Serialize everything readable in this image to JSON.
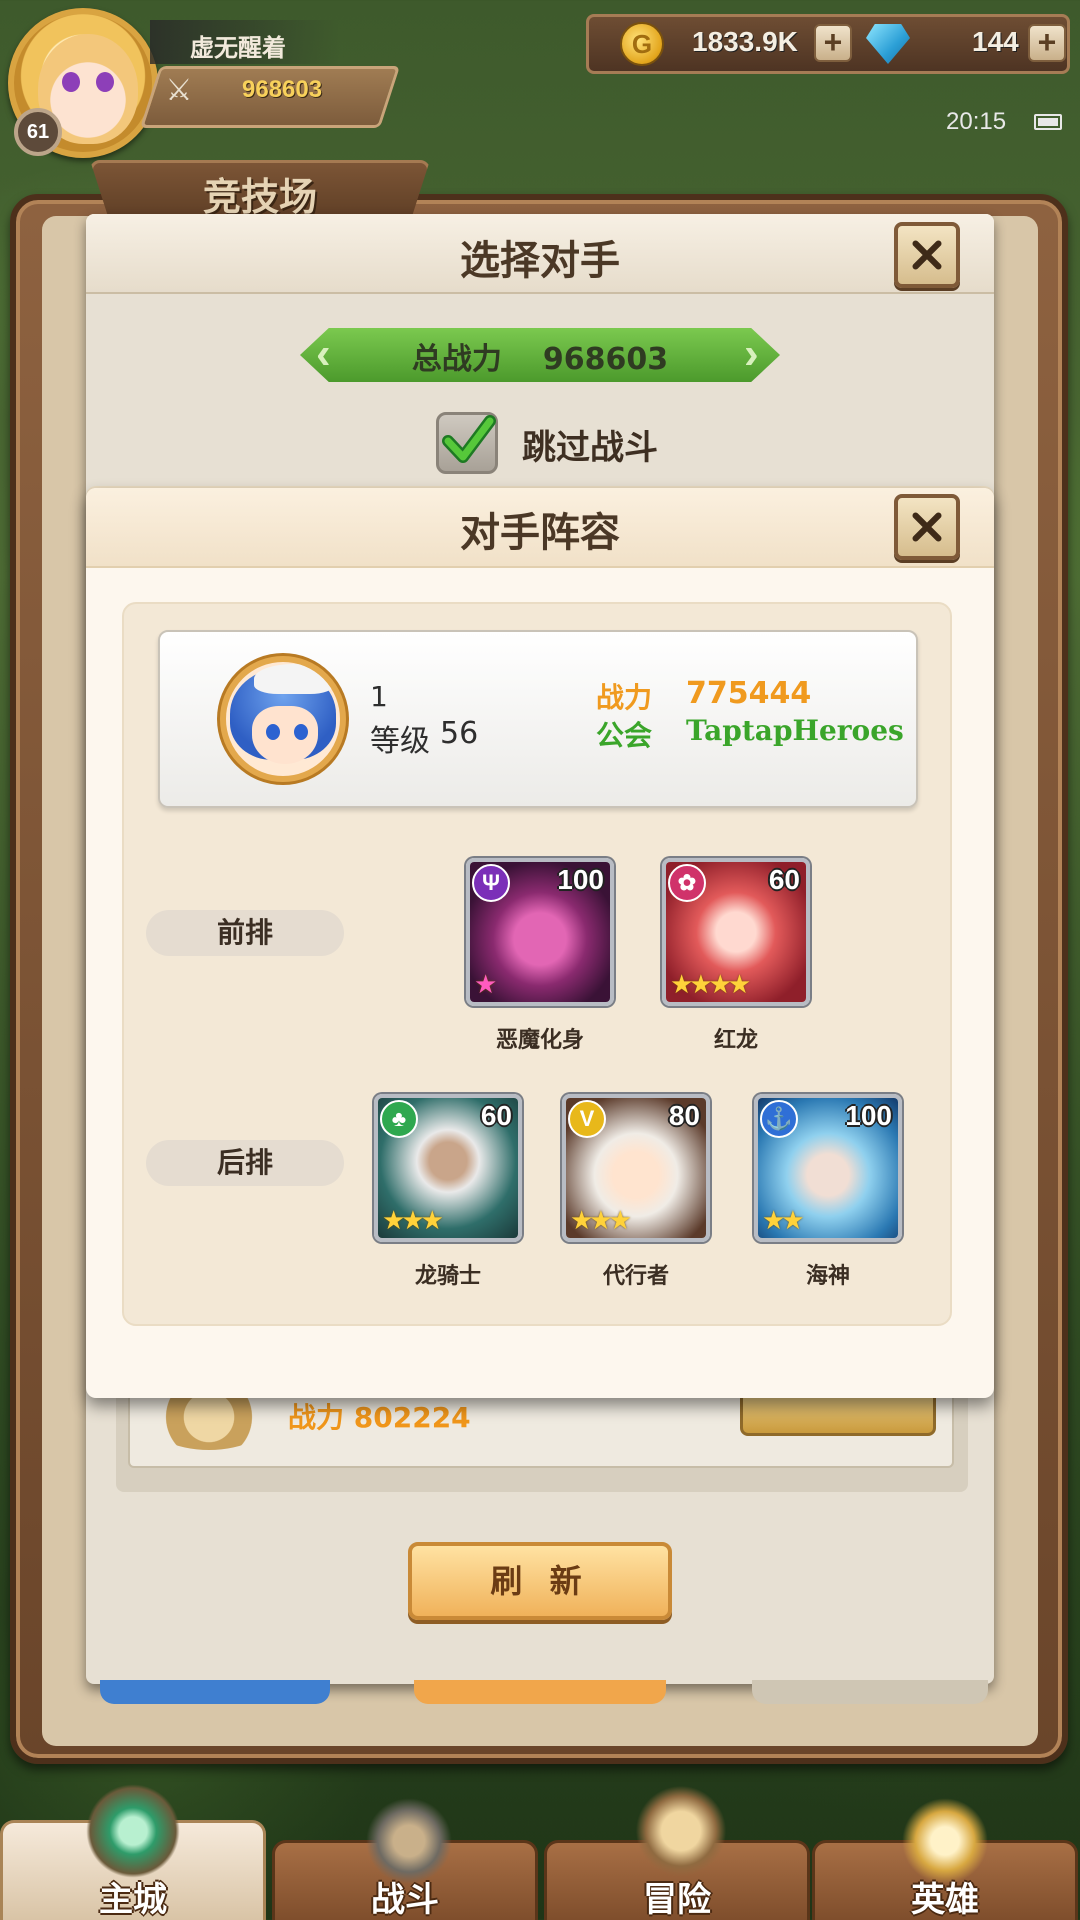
{
  "player": {
    "name": "虚无醒着",
    "level": "61",
    "power": "968603"
  },
  "resources": {
    "gold": "1833.9K",
    "gems": "144"
  },
  "status": {
    "time": "20:15"
  },
  "arena": {
    "title": "竞技场"
  },
  "select_opponent": {
    "title": "选择对手",
    "total_power_label": "总战力",
    "total_power_value": "968603",
    "skip_battle_label": "跳过战斗",
    "skip_battle_checked": true,
    "refresh_label": "刷 新",
    "peek_power_label": "战力",
    "peek_power_value": "802224"
  },
  "lineup": {
    "title": "对手阵容",
    "opponent": {
      "name": "1",
      "level_label": "等级",
      "level": "56",
      "power_label": "战力",
      "power": "775444",
      "guild_label": "公会",
      "guild": "TaptapHeroes"
    },
    "front_row_label": "前排",
    "back_row_label": "后排",
    "front_row": [
      {
        "name": "恶魔化身",
        "level": "100",
        "stars": "★",
        "faction_icon": "demon-horns-icon",
        "faction_color": "#7b2fb8"
      },
      {
        "name": "红龙",
        "level": "60",
        "stars": "★★★★",
        "faction_icon": "flower-icon",
        "faction_color": "#d0326a"
      }
    ],
    "back_row": [
      {
        "name": "龙骑士",
        "level": "60",
        "stars": "★★★",
        "faction_icon": "forest-icon",
        "faction_color": "#2fa84f"
      },
      {
        "name": "代行者",
        "level": "80",
        "stars": "★★★",
        "faction_icon": "light-icon",
        "faction_color": "#e8b81a"
      },
      {
        "name": "海神",
        "level": "100",
        "stars": "★★",
        "faction_icon": "anchor-icon",
        "faction_color": "#2f6fd6"
      }
    ]
  },
  "nav": {
    "items": [
      {
        "label": "主城",
        "icon": "castle-icon",
        "active": true
      },
      {
        "label": "战斗",
        "icon": "crossed-swords-icon",
        "active": false
      },
      {
        "label": "冒险",
        "icon": "map-scroll-icon",
        "active": false
      },
      {
        "label": "英雄",
        "icon": "hero-crest-icon",
        "active": false
      }
    ]
  }
}
